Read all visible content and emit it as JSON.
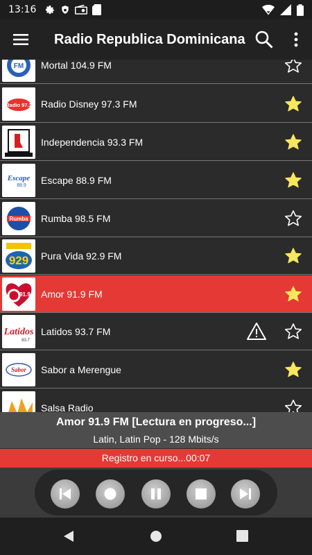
{
  "status": {
    "time": "13:16"
  },
  "appbar": {
    "title": "Radio Republica Dominicana"
  },
  "stations": [
    {
      "name": "Mortal 104.9 FM",
      "fav": false,
      "logo": "logo-mortal",
      "warn": false
    },
    {
      "name": "Radio Disney 97.3 FM",
      "fav": true,
      "logo": "logo-disney",
      "warn": false
    },
    {
      "name": "Independencia 93.3 FM",
      "fav": true,
      "logo": "logo-independencia",
      "warn": false
    },
    {
      "name": "Escape 88.9 FM",
      "fav": true,
      "logo": "logo-escape",
      "warn": false
    },
    {
      "name": "Rumba 98.5 FM",
      "fav": false,
      "logo": "logo-rumba",
      "warn": false
    },
    {
      "name": "Pura Vida 92.9 FM",
      "fav": true,
      "logo": "logo-puravida",
      "warn": false
    },
    {
      "name": "Amor 91.9 FM",
      "fav": true,
      "logo": "logo-amor",
      "warn": false,
      "active": true
    },
    {
      "name": "Latidos 93.7 FM",
      "fav": false,
      "logo": "logo-latidos",
      "warn": true
    },
    {
      "name": "Sabor a Merengue",
      "fav": true,
      "logo": "logo-sabor",
      "warn": false
    },
    {
      "name": "Salsa Radio",
      "fav": false,
      "logo": "logo-salsa",
      "warn": false
    }
  ],
  "logo_text": {
    "disney": "Radio 97.3",
    "independencia": "Independencia",
    "escape": "Escape 88.9",
    "rumba": "Rumba",
    "puravida": "929",
    "amor": "91.9",
    "latidos": "Latidos",
    "sabor": "Sabor"
  },
  "nowplaying": {
    "title": "Amor 91.9 FM  [Lectura en progreso...]",
    "info": "Latin, Latin Pop - 128 Mbits/s",
    "recording": "Registro en curso...00:07"
  },
  "colors": {
    "accent": "#e53935",
    "star": "#f7e75c",
    "bg": "#2b2b2b"
  }
}
